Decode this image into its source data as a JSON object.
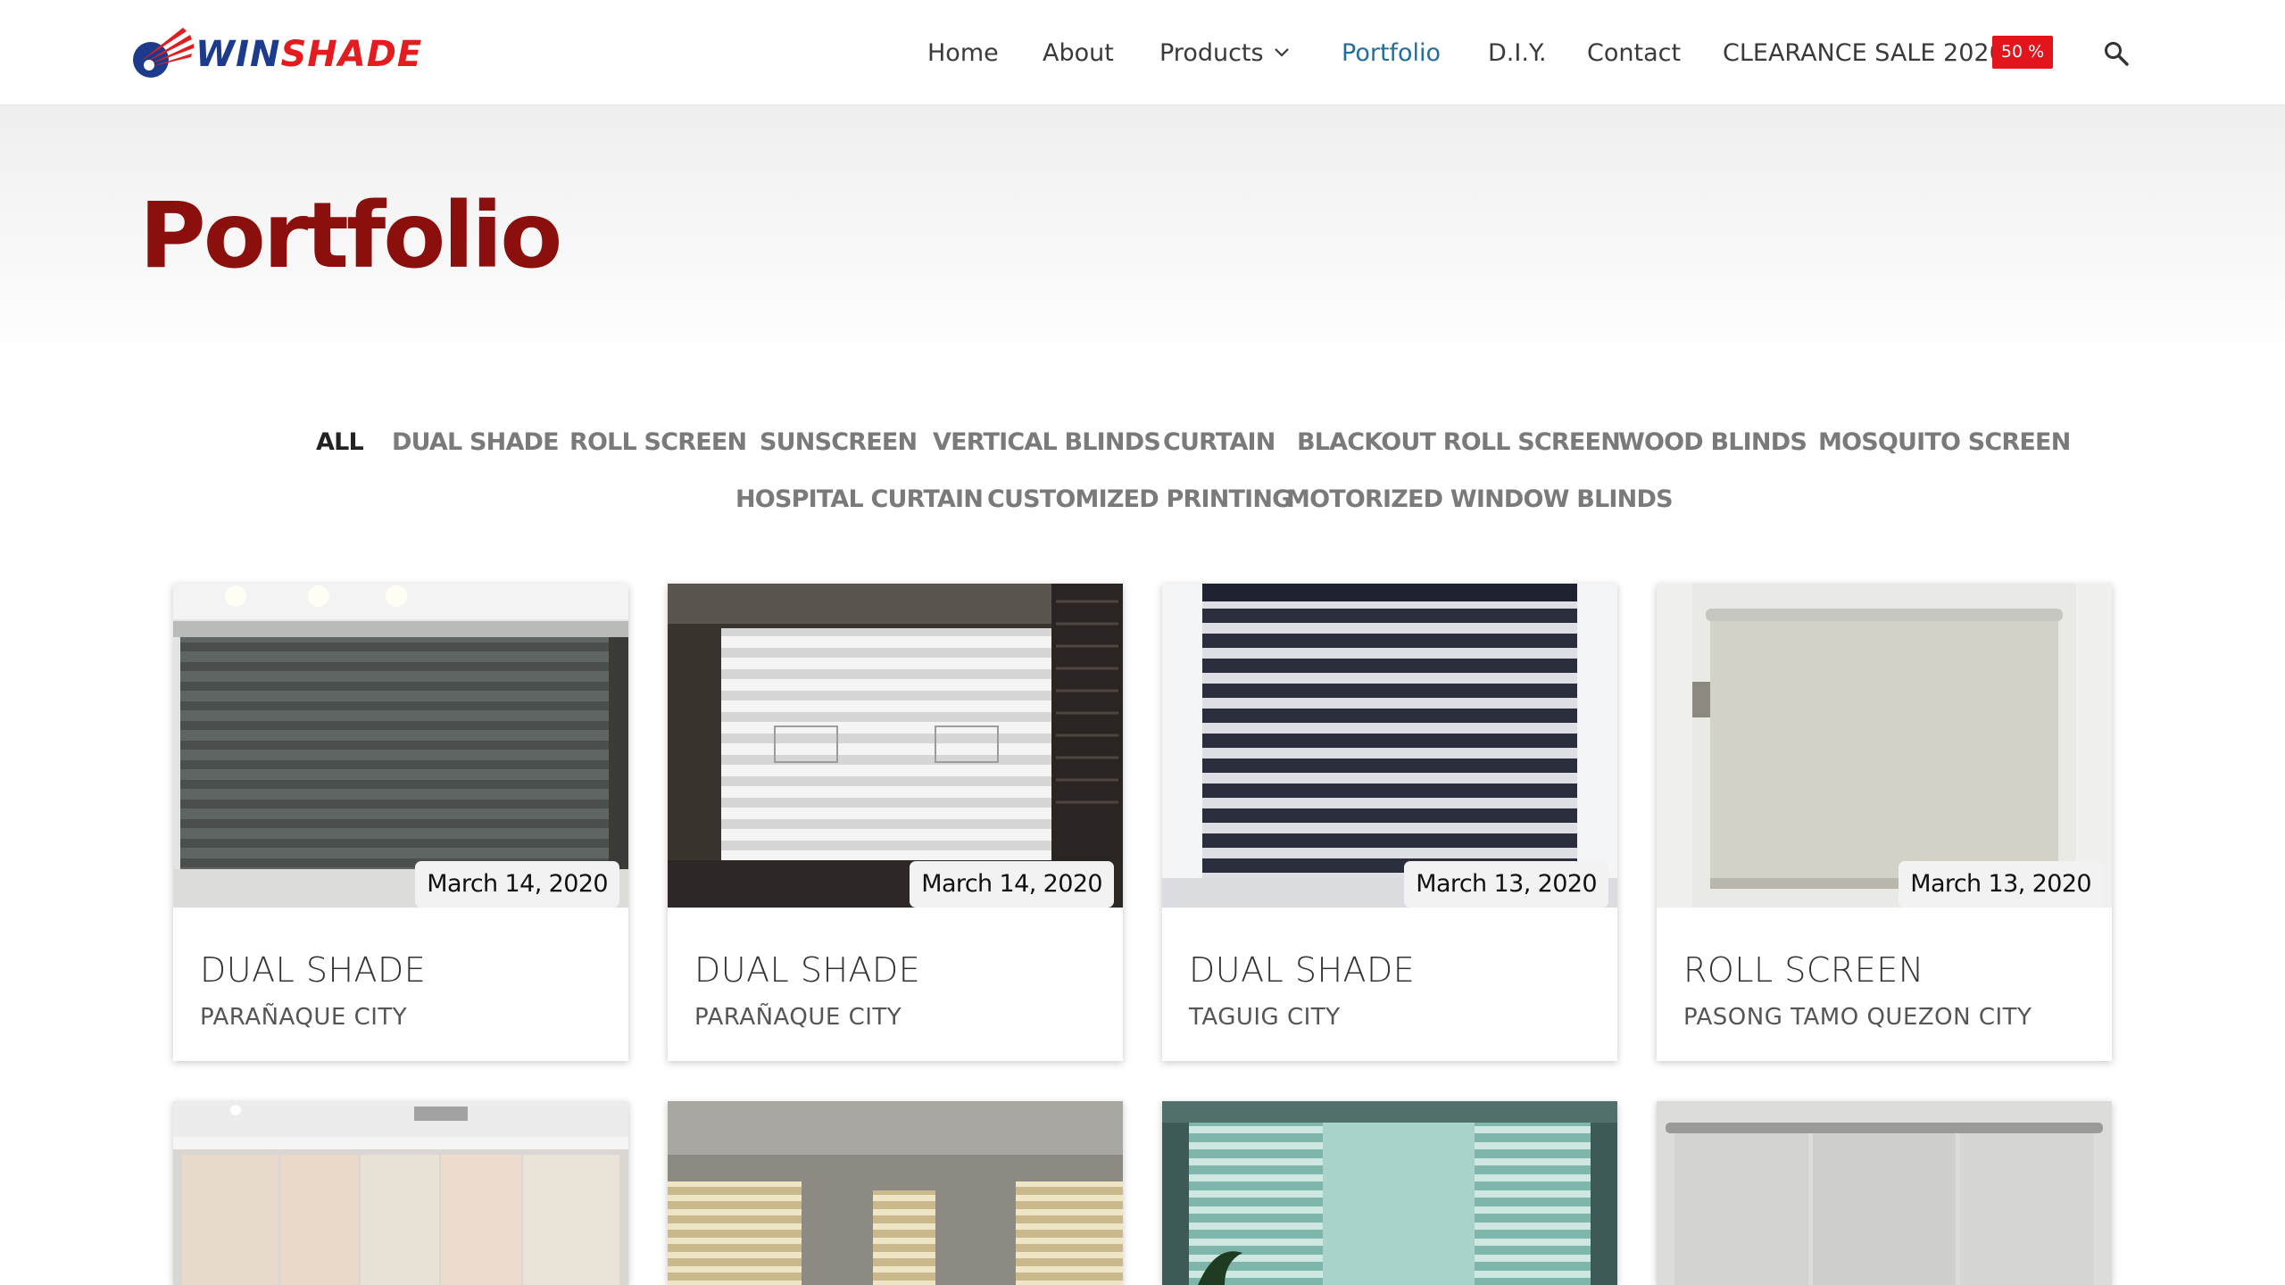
{
  "brand": {
    "logo_part1": "WIN",
    "logo_part2": "SHADE"
  },
  "nav": {
    "home": "Home",
    "about": "About",
    "products": "Products",
    "portfolio": "Portfolio",
    "diy": "D.I.Y.",
    "contact": "Contact",
    "sale": "CLEARANCE SALE 2020",
    "sale_badge": "50 %"
  },
  "page": {
    "title": "Portfolio"
  },
  "filters": [
    "ALL",
    "DUAL SHADE",
    "ROLL SCREEN",
    "SUNSCREEN",
    "VERTICAL BLINDS",
    "CURTAIN",
    "BLACKOUT ROLL SCREEN",
    "WOOD BLINDS",
    "MOSQUITO SCREEN",
    "HOSPITAL CURTAIN",
    "CUSTOMIZED PRINTING",
    "MOTORIZED WINDOW BLINDS"
  ],
  "active_filter": "ALL",
  "cards": [
    {
      "date": "March 14, 2020",
      "title": "DUAL SHADE",
      "location": "PARAÑAQUE CITY"
    },
    {
      "date": "March 14, 2020",
      "title": "DUAL SHADE",
      "location": "PARAÑAQUE CITY"
    },
    {
      "date": "March 13, 2020",
      "title": "DUAL SHADE",
      "location": "TAGUIG CITY"
    },
    {
      "date": "March 13, 2020",
      "title": "ROLL SCREEN",
      "location": "PASONG TAMO QUEZON CITY"
    }
  ],
  "colors": {
    "brand_blue": "#1c3b8c",
    "brand_red": "#e21c1f",
    "title_red": "#8b0f0c",
    "nav_active": "#1f6f9f",
    "sale_badge": "#e3141b"
  }
}
